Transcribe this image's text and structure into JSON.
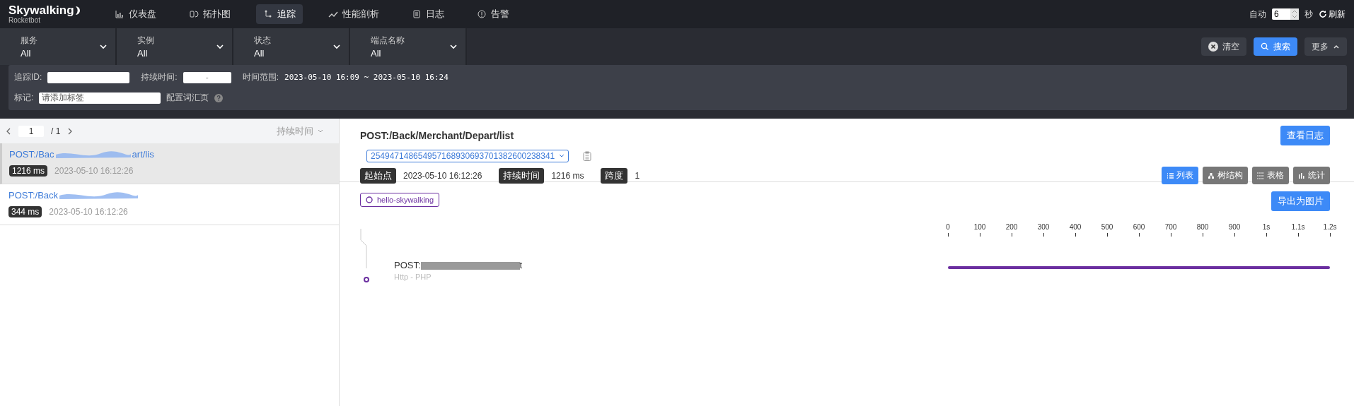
{
  "header": {
    "logo": "Skywalking",
    "logo_subtitle": "Rocketbot",
    "nav": [
      {
        "label": "仪表盘",
        "kind": "bars",
        "selected": false
      },
      {
        "label": "拓扑图",
        "kind": "topology",
        "selected": false
      },
      {
        "label": "追踪",
        "kind": "trace",
        "selected": true
      },
      {
        "label": "性能剖析",
        "kind": "trend",
        "selected": false
      },
      {
        "label": "日志",
        "kind": "log",
        "selected": false
      },
      {
        "label": "告警",
        "kind": "alert",
        "selected": false
      }
    ],
    "auto_refresh": {
      "label": "自动",
      "interval": "6",
      "unit": "秒",
      "refresh": "刷新"
    }
  },
  "filters": {
    "selects": [
      {
        "label": "服务",
        "value": "All"
      },
      {
        "label": "实例",
        "value": "All"
      },
      {
        "label": "状态",
        "value": "All"
      },
      {
        "label": "端点名称",
        "value": "All"
      }
    ],
    "buttons": [
      {
        "kind": "clear",
        "label": "清空"
      },
      {
        "kind": "search",
        "label": "搜索"
      },
      {
        "kind": "more",
        "label": "更多",
        "expanded": true
      }
    ],
    "trace_id": {
      "label": "追踪ID:"
    },
    "duration": {
      "label": "持续时间:",
      "separator": "-"
    },
    "time_range": {
      "label": "时间范围:",
      "value": "2023-05-10 16:09 ~ 2023-05-10 16:24"
    },
    "tags": {
      "label": "标记:",
      "placeholder": "请添加标签",
      "link": "配置词汇页"
    }
  },
  "trace_list": {
    "page": "1",
    "total_pages": "/ 1",
    "sort": "持续时间",
    "items": [
      {
        "endpoint": "POST:/Bac",
        "endpoint_tail": "art/lis",
        "duration": "1216 ms",
        "start": "2023-05-10 16:12:26",
        "selected": true
      },
      {
        "endpoint": "POST:/Back",
        "duration": "344 ms",
        "start": "2023-05-10 16:12:26",
        "selected": false
      }
    ]
  },
  "detail": {
    "title": "POST:/Back/Merchant/Depart/list",
    "trace_id": "254947148654957168930693701382600238341",
    "view_logs": "查看日志",
    "stats": [
      {
        "label": "起始点",
        "value": "2023-05-10 16:12:26"
      },
      {
        "label": "持续时间",
        "value": "1216 ms"
      },
      {
        "label": "跨度",
        "value": "1"
      }
    ],
    "views": [
      {
        "label": "列表",
        "kind": "list",
        "selected": true
      },
      {
        "label": "树结构",
        "kind": "tree",
        "selected": false
      },
      {
        "label": "表格",
        "kind": "table",
        "selected": false
      },
      {
        "label": "统计",
        "kind": "stats",
        "selected": false
      }
    ],
    "service": "hello-skywalking",
    "export": "导出为图片",
    "axis": [
      "0",
      "100",
      "200",
      "300",
      "400",
      "500",
      "600",
      "700",
      "800",
      "900",
      "1s",
      "1.1s",
      "1.2s"
    ],
    "spans": [
      {
        "name": "POST:",
        "name_tail": "t",
        "component": "Http - PHP",
        "level": 1
      }
    ]
  }
}
